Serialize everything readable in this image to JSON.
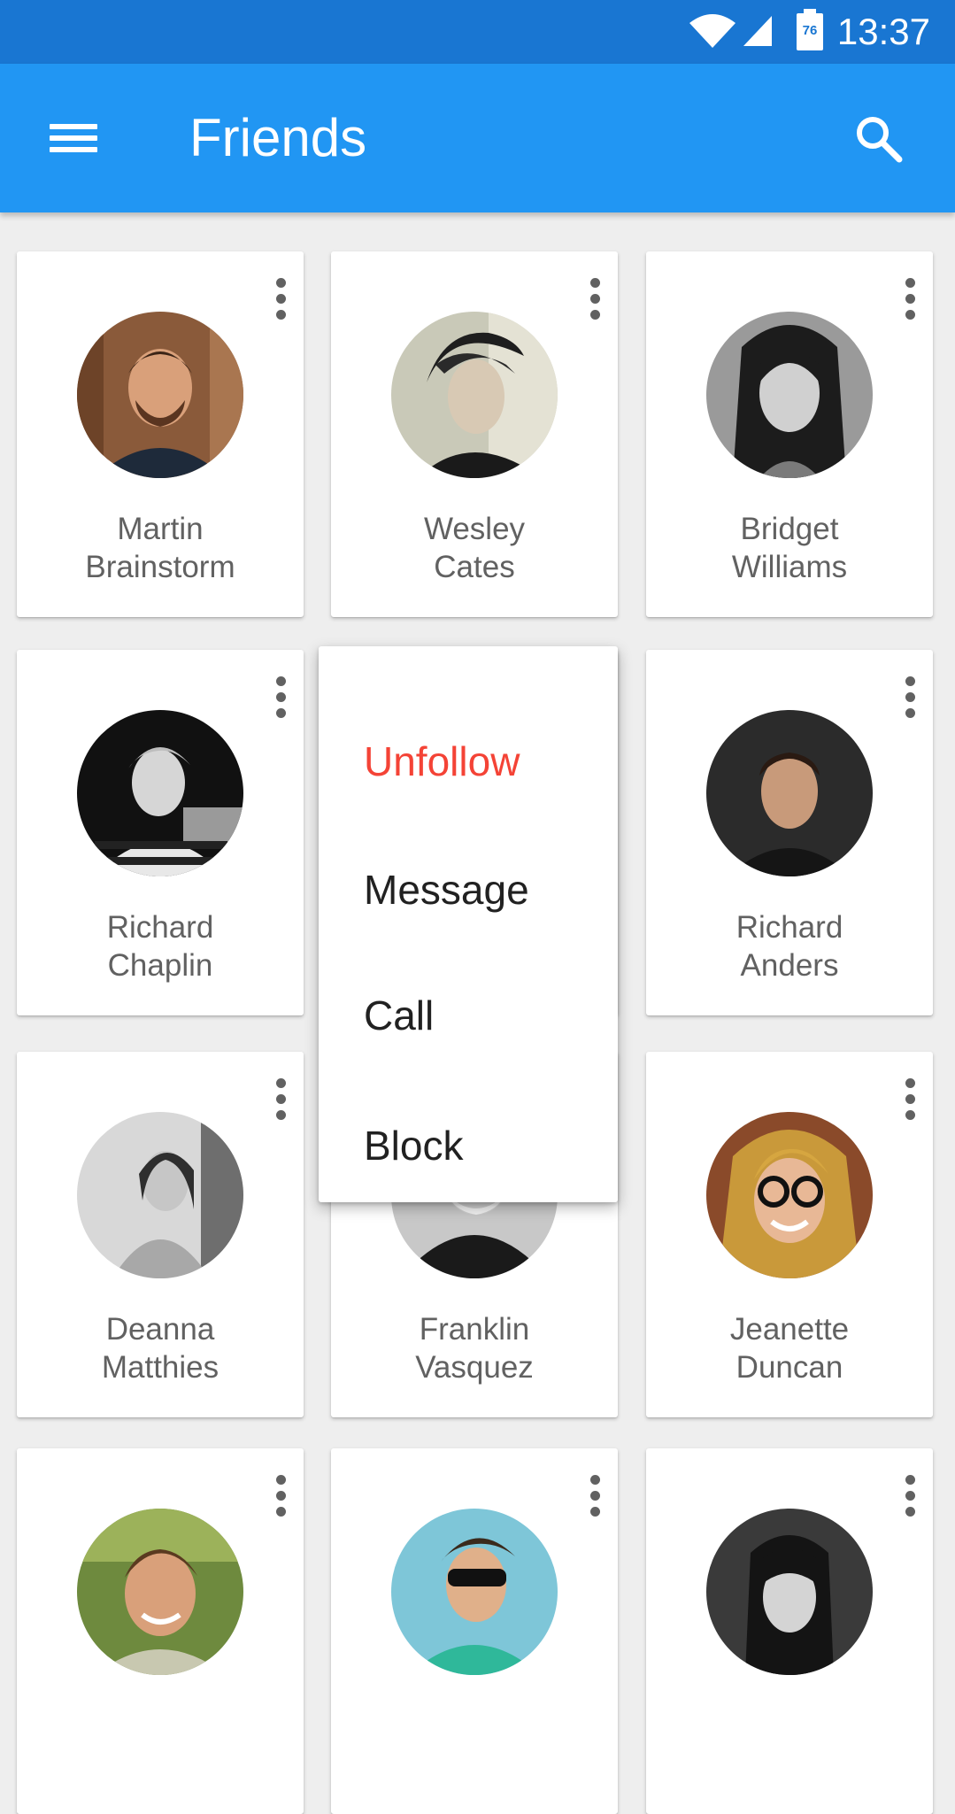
{
  "status_bar": {
    "time": "13:37",
    "battery_label": "76",
    "icons": [
      "wifi-icon",
      "signal-icon",
      "battery-icon"
    ]
  },
  "app_bar": {
    "title": "Friends",
    "icons": [
      "menu-icon",
      "search-icon"
    ]
  },
  "colors": {
    "status_bar": "#1976d2",
    "app_bar": "#2196f3",
    "danger": "#f44336",
    "background": "#eeeeee"
  },
  "friends": [
    {
      "first": "Martin",
      "last": "Brainstorm"
    },
    {
      "first": "Wesley",
      "last": "Cates"
    },
    {
      "first": "Bridget",
      "last": "Williams"
    },
    {
      "first": "Richard",
      "last": "Chaplin"
    },
    {
      "first": "",
      "last": ""
    },
    {
      "first": "Richard",
      "last": "Anders"
    },
    {
      "first": "Deanna",
      "last": "Matthies"
    },
    {
      "first": "Franklin",
      "last": "Vasquez"
    },
    {
      "first": "Jeanette",
      "last": "Duncan"
    }
  ],
  "context_menu": {
    "items": [
      {
        "label": "Unfollow",
        "style": "danger"
      },
      {
        "label": "Message"
      },
      {
        "label": "Call"
      },
      {
        "label": "Block"
      }
    ]
  }
}
